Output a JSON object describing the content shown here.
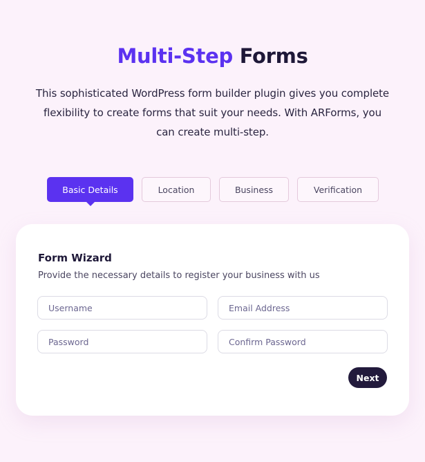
{
  "header": {
    "title_accent": "Multi-Step",
    "title_rest": "Forms",
    "description": "This sophisticated WordPress form builder plugin gives you complete flexibility to create forms that suit your needs. With ARForms, you can create multi-step."
  },
  "tabs": [
    {
      "label": "Basic Details",
      "active": true
    },
    {
      "label": "Location",
      "active": false
    },
    {
      "label": "Business",
      "active": false
    },
    {
      "label": "Verification",
      "active": false
    }
  ],
  "form": {
    "title": "Form Wizard",
    "subtitle": "Provide the necessary details to register your business with us",
    "fields": {
      "username": {
        "placeholder": "Username",
        "value": ""
      },
      "email": {
        "placeholder": "Email Address",
        "value": ""
      },
      "password": {
        "placeholder": "Password",
        "value": ""
      },
      "confirm_password": {
        "placeholder": "Confirm Password",
        "value": ""
      }
    },
    "next_label": "Next"
  },
  "colors": {
    "accent": "#5b32f0",
    "dark": "#1e1838",
    "background": "#fcf2fb"
  }
}
